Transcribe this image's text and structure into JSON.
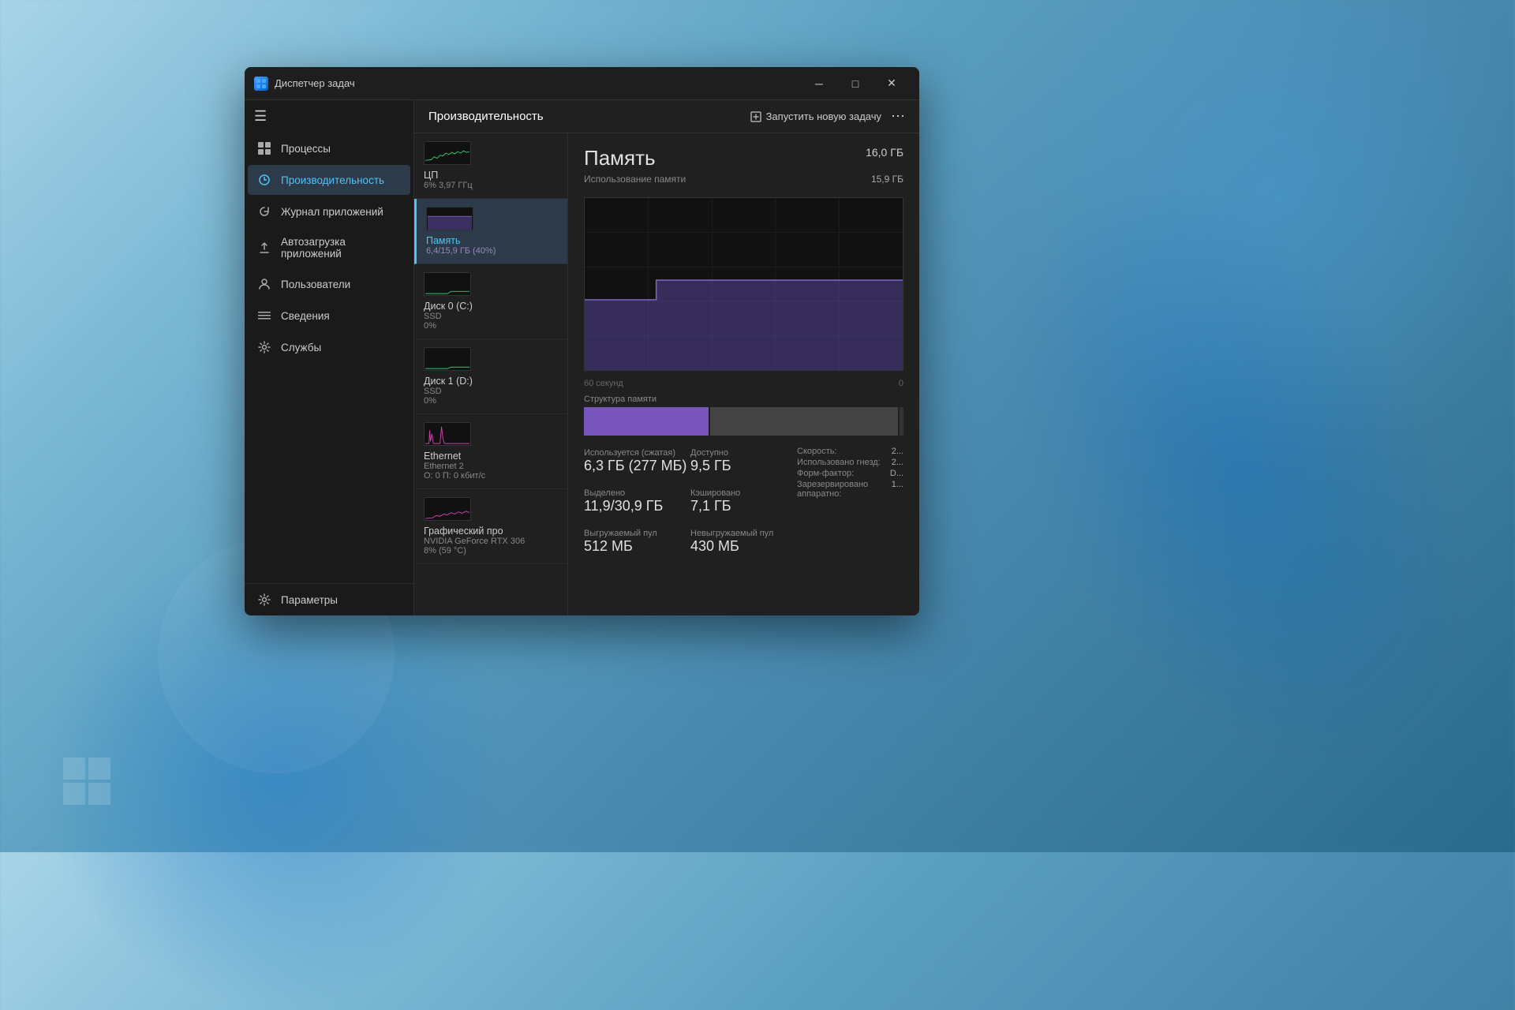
{
  "window": {
    "title": "Диспетчер задач",
    "minimize_label": "─",
    "maximize_label": "□",
    "close_label": "✕"
  },
  "sidebar": {
    "hamburger": "☰",
    "items": [
      {
        "id": "processes",
        "label": "Процессы",
        "icon": "⊞",
        "active": false
      },
      {
        "id": "performance",
        "label": "Производительность",
        "icon": "◎",
        "active": true
      },
      {
        "id": "app-history",
        "label": "Журнал приложений",
        "icon": "⟳",
        "active": false
      },
      {
        "id": "startup",
        "label": "Автозагрузка приложений",
        "icon": "⚡",
        "active": false
      },
      {
        "id": "users",
        "label": "Пользователи",
        "icon": "⊕",
        "active": false
      },
      {
        "id": "details",
        "label": "Сведения",
        "icon": "≡",
        "active": false
      },
      {
        "id": "services",
        "label": "Службы",
        "icon": "⚙",
        "active": false
      }
    ],
    "settings": {
      "label": "Параметры",
      "icon": "⚙"
    }
  },
  "panel": {
    "title": "Производительность",
    "new_task_label": "Запустить новую задачу",
    "more_icon": "⋯"
  },
  "devices": [
    {
      "id": "cpu",
      "name": "ЦП",
      "sub": "6% 3,97 ГГц",
      "type": "cpu"
    },
    {
      "id": "memory",
      "name": "Память",
      "sub": "6,4/15,9 ГБ (40%)",
      "type": "memory",
      "active": true
    },
    {
      "id": "disk0",
      "name": "Диск 0 (C:)",
      "sub": "SSD",
      "val": "0%",
      "type": "disk"
    },
    {
      "id": "disk1",
      "name": "Диск 1 (D:)",
      "sub": "SSD",
      "val": "0%",
      "type": "disk"
    },
    {
      "id": "ethernet",
      "name": "Ethernet",
      "sub": "Ethernet 2",
      "val": "О: 0 П: 0 кбит/с",
      "type": "network"
    },
    {
      "id": "gpu",
      "name": "Графический про",
      "sub": "NVIDIA GeForce RTX 306",
      "val": "8% (59 °C)",
      "type": "gpu"
    }
  ],
  "memory_detail": {
    "title": "Память",
    "total": "16,0 ГБ",
    "usage_label": "Использование памяти",
    "used": "15,9 ГБ",
    "graph_time_left": "60 секунд",
    "graph_time_right": "0",
    "structure_label": "Структура памяти",
    "stats": {
      "in_use_label": "Используется (сжатая)",
      "in_use_val": "6,3 ГБ (277 МБ)",
      "available_label": "Доступно",
      "available_val": "9,5 ГБ",
      "allocated_label": "Выделено",
      "allocated_val": "11,9/30,9 ГБ",
      "cached_label": "Кэшировано",
      "cached_val": "7,1 ГБ",
      "pageable_label": "Выгружаемый пул",
      "pageable_val": "512 МБ",
      "nonpageable_label": "Невыгружаемый пул",
      "nonpageable_val": "430 МБ",
      "speed_label": "Скорость:",
      "speed_val": "2...",
      "slots_used_label": "Использовано гнезд:",
      "slots_used_val": "2...",
      "form_factor_label": "Форм-фактор:",
      "form_factor_val": "D...",
      "hw_reserved_label": "Зарезервировано аппаратно:",
      "hw_reserved_val": "1..."
    }
  }
}
